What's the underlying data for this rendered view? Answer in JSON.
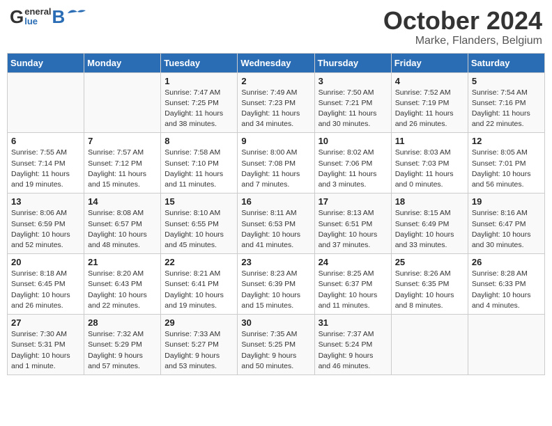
{
  "header": {
    "logo_line1": "General",
    "logo_line2": "Blue",
    "month": "October 2024",
    "location": "Marke, Flanders, Belgium"
  },
  "days_of_week": [
    "Sunday",
    "Monday",
    "Tuesday",
    "Wednesday",
    "Thursday",
    "Friday",
    "Saturday"
  ],
  "weeks": [
    [
      {
        "num": "",
        "sunrise": "",
        "sunset": "",
        "daylight": ""
      },
      {
        "num": "",
        "sunrise": "",
        "sunset": "",
        "daylight": ""
      },
      {
        "num": "1",
        "sunrise": "Sunrise: 7:47 AM",
        "sunset": "Sunset: 7:25 PM",
        "daylight": "Daylight: 11 hours and 38 minutes."
      },
      {
        "num": "2",
        "sunrise": "Sunrise: 7:49 AM",
        "sunset": "Sunset: 7:23 PM",
        "daylight": "Daylight: 11 hours and 34 minutes."
      },
      {
        "num": "3",
        "sunrise": "Sunrise: 7:50 AM",
        "sunset": "Sunset: 7:21 PM",
        "daylight": "Daylight: 11 hours and 30 minutes."
      },
      {
        "num": "4",
        "sunrise": "Sunrise: 7:52 AM",
        "sunset": "Sunset: 7:19 PM",
        "daylight": "Daylight: 11 hours and 26 minutes."
      },
      {
        "num": "5",
        "sunrise": "Sunrise: 7:54 AM",
        "sunset": "Sunset: 7:16 PM",
        "daylight": "Daylight: 11 hours and 22 minutes."
      }
    ],
    [
      {
        "num": "6",
        "sunrise": "Sunrise: 7:55 AM",
        "sunset": "Sunset: 7:14 PM",
        "daylight": "Daylight: 11 hours and 19 minutes."
      },
      {
        "num": "7",
        "sunrise": "Sunrise: 7:57 AM",
        "sunset": "Sunset: 7:12 PM",
        "daylight": "Daylight: 11 hours and 15 minutes."
      },
      {
        "num": "8",
        "sunrise": "Sunrise: 7:58 AM",
        "sunset": "Sunset: 7:10 PM",
        "daylight": "Daylight: 11 hours and 11 minutes."
      },
      {
        "num": "9",
        "sunrise": "Sunrise: 8:00 AM",
        "sunset": "Sunset: 7:08 PM",
        "daylight": "Daylight: 11 hours and 7 minutes."
      },
      {
        "num": "10",
        "sunrise": "Sunrise: 8:02 AM",
        "sunset": "Sunset: 7:06 PM",
        "daylight": "Daylight: 11 hours and 3 minutes."
      },
      {
        "num": "11",
        "sunrise": "Sunrise: 8:03 AM",
        "sunset": "Sunset: 7:03 PM",
        "daylight": "Daylight: 11 hours and 0 minutes."
      },
      {
        "num": "12",
        "sunrise": "Sunrise: 8:05 AM",
        "sunset": "Sunset: 7:01 PM",
        "daylight": "Daylight: 10 hours and 56 minutes."
      }
    ],
    [
      {
        "num": "13",
        "sunrise": "Sunrise: 8:06 AM",
        "sunset": "Sunset: 6:59 PM",
        "daylight": "Daylight: 10 hours and 52 minutes."
      },
      {
        "num": "14",
        "sunrise": "Sunrise: 8:08 AM",
        "sunset": "Sunset: 6:57 PM",
        "daylight": "Daylight: 10 hours and 48 minutes."
      },
      {
        "num": "15",
        "sunrise": "Sunrise: 8:10 AM",
        "sunset": "Sunset: 6:55 PM",
        "daylight": "Daylight: 10 hours and 45 minutes."
      },
      {
        "num": "16",
        "sunrise": "Sunrise: 8:11 AM",
        "sunset": "Sunset: 6:53 PM",
        "daylight": "Daylight: 10 hours and 41 minutes."
      },
      {
        "num": "17",
        "sunrise": "Sunrise: 8:13 AM",
        "sunset": "Sunset: 6:51 PM",
        "daylight": "Daylight: 10 hours and 37 minutes."
      },
      {
        "num": "18",
        "sunrise": "Sunrise: 8:15 AM",
        "sunset": "Sunset: 6:49 PM",
        "daylight": "Daylight: 10 hours and 33 minutes."
      },
      {
        "num": "19",
        "sunrise": "Sunrise: 8:16 AM",
        "sunset": "Sunset: 6:47 PM",
        "daylight": "Daylight: 10 hours and 30 minutes."
      }
    ],
    [
      {
        "num": "20",
        "sunrise": "Sunrise: 8:18 AM",
        "sunset": "Sunset: 6:45 PM",
        "daylight": "Daylight: 10 hours and 26 minutes."
      },
      {
        "num": "21",
        "sunrise": "Sunrise: 8:20 AM",
        "sunset": "Sunset: 6:43 PM",
        "daylight": "Daylight: 10 hours and 22 minutes."
      },
      {
        "num": "22",
        "sunrise": "Sunrise: 8:21 AM",
        "sunset": "Sunset: 6:41 PM",
        "daylight": "Daylight: 10 hours and 19 minutes."
      },
      {
        "num": "23",
        "sunrise": "Sunrise: 8:23 AM",
        "sunset": "Sunset: 6:39 PM",
        "daylight": "Daylight: 10 hours and 15 minutes."
      },
      {
        "num": "24",
        "sunrise": "Sunrise: 8:25 AM",
        "sunset": "Sunset: 6:37 PM",
        "daylight": "Daylight: 10 hours and 11 minutes."
      },
      {
        "num": "25",
        "sunrise": "Sunrise: 8:26 AM",
        "sunset": "Sunset: 6:35 PM",
        "daylight": "Daylight: 10 hours and 8 minutes."
      },
      {
        "num": "26",
        "sunrise": "Sunrise: 8:28 AM",
        "sunset": "Sunset: 6:33 PM",
        "daylight": "Daylight: 10 hours and 4 minutes."
      }
    ],
    [
      {
        "num": "27",
        "sunrise": "Sunrise: 7:30 AM",
        "sunset": "Sunset: 5:31 PM",
        "daylight": "Daylight: 10 hours and 1 minute."
      },
      {
        "num": "28",
        "sunrise": "Sunrise: 7:32 AM",
        "sunset": "Sunset: 5:29 PM",
        "daylight": "Daylight: 9 hours and 57 minutes."
      },
      {
        "num": "29",
        "sunrise": "Sunrise: 7:33 AM",
        "sunset": "Sunset: 5:27 PM",
        "daylight": "Daylight: 9 hours and 53 minutes."
      },
      {
        "num": "30",
        "sunrise": "Sunrise: 7:35 AM",
        "sunset": "Sunset: 5:25 PM",
        "daylight": "Daylight: 9 hours and 50 minutes."
      },
      {
        "num": "31",
        "sunrise": "Sunrise: 7:37 AM",
        "sunset": "Sunset: 5:24 PM",
        "daylight": "Daylight: 9 hours and 46 minutes."
      },
      {
        "num": "",
        "sunrise": "",
        "sunset": "",
        "daylight": ""
      },
      {
        "num": "",
        "sunrise": "",
        "sunset": "",
        "daylight": ""
      }
    ]
  ]
}
